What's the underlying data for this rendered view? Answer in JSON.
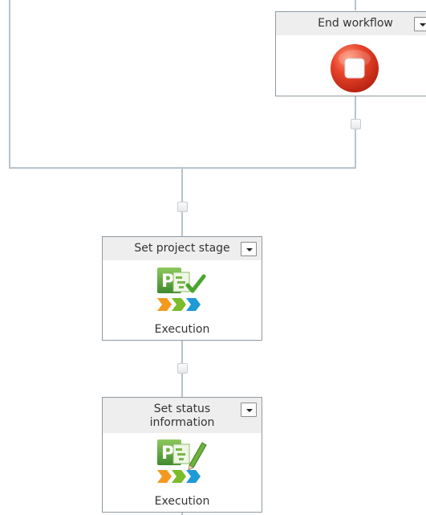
{
  "actions": {
    "end_workflow": {
      "title": "End workflow",
      "icon": "stop-icon"
    },
    "set_project_stage": {
      "title": "Set project stage",
      "icon": "project-stage-icon",
      "caption": "Execution"
    },
    "set_status_information": {
      "title_line1": "Set status",
      "title_line2": "information",
      "icon": "project-status-edit-icon",
      "caption": "Execution"
    }
  },
  "colors": {
    "connector_line": "#b7c3cc",
    "header_bg": "#eeeeee",
    "stop_red": "#e0402a",
    "chevron_orange": "#f39a1e",
    "chevron_green": "#7cbb2a",
    "chevron_blue": "#1e9ad6",
    "project_green": "#4f9a3a"
  }
}
